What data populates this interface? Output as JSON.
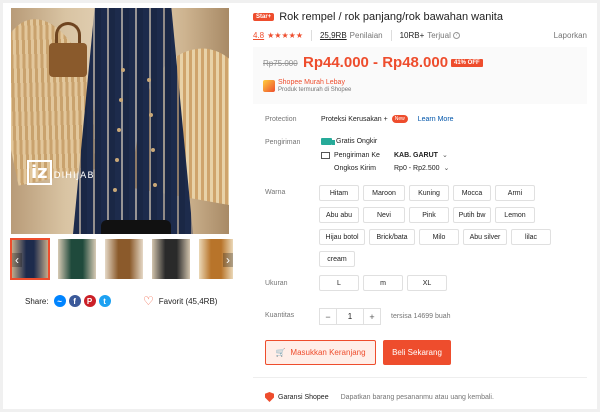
{
  "gallery": {
    "watermark_brand": "iz",
    "watermark_text": "DIHIJAB",
    "thumbs": [
      {
        "colour": "#1d2b4c"
      },
      {
        "colour": "#1f4a3c"
      },
      {
        "colour": "#8b5a2b"
      },
      {
        "colour": "#2a2a2a"
      },
      {
        "colour": "#b8742a"
      }
    ],
    "prev_icon": "‹",
    "next_icon": "›"
  },
  "share": {
    "label": "Share:",
    "networks": [
      {
        "name": "messenger",
        "glyph": "~",
        "color": "#0084ff"
      },
      {
        "name": "facebook",
        "glyph": "f",
        "color": "#3b5999"
      },
      {
        "name": "pinterest",
        "glyph": "P",
        "color": "#cb2027"
      },
      {
        "name": "twitter",
        "glyph": "t",
        "color": "#1da1f2"
      }
    ]
  },
  "favorite": {
    "label": "Favorit (45,4RB)"
  },
  "product": {
    "badge": "Star+",
    "title": "Rok rempel / rok panjang/rok bawahan wanita",
    "rating": "4.8",
    "stars": "★★★★★",
    "reviews_count": "25,9RB",
    "reviews_label": "Penilaian",
    "sold_count": "10RB+",
    "sold_label": "Terjual",
    "report": "Laporkan"
  },
  "price": {
    "original": "Rp75.000",
    "current": "Rp44.000 - Rp48.000",
    "discount": "41% OFF",
    "promo_title": "Shopee Murah Lebay",
    "promo_sub": "Produk termurah di Shopee"
  },
  "protection": {
    "label": "Protection",
    "name": "Proteksi Kerusakan +",
    "badge": "New",
    "link": "Learn More"
  },
  "shipping": {
    "label": "Pengiriman",
    "free": "Gratis Ongkir",
    "to_label": "Pengiriman Ke",
    "to_value": "KAB. GARUT",
    "cost_label": "Ongkos Kirim",
    "cost_value": "Rp0 - Rp2.500"
  },
  "variants": {
    "label": "Warna",
    "options": [
      "Hitam",
      "Maroon",
      "Kuning",
      "Mocca",
      "Armi",
      "Abu abu",
      "Nevi",
      "Pink",
      "Putih bw",
      "Lemon",
      "Hijau botol",
      "Brick/bata",
      "Milo",
      "Abu silver",
      "lilac",
      "cream"
    ]
  },
  "sizes": {
    "label": "Ukuran",
    "options": [
      "L",
      "m",
      "XL"
    ]
  },
  "quantity": {
    "label": "Kuantitas",
    "minus": "−",
    "value": "1",
    "plus": "+",
    "stock": "tersisa 14699 buah"
  },
  "actions": {
    "add_to_cart": "Masukkan Keranjang",
    "buy_now": "Beli Sekarang"
  },
  "guarantee": {
    "title": "Garansi Shopee",
    "text": "Dapatkan barang pesananmu atau uang kembali."
  }
}
